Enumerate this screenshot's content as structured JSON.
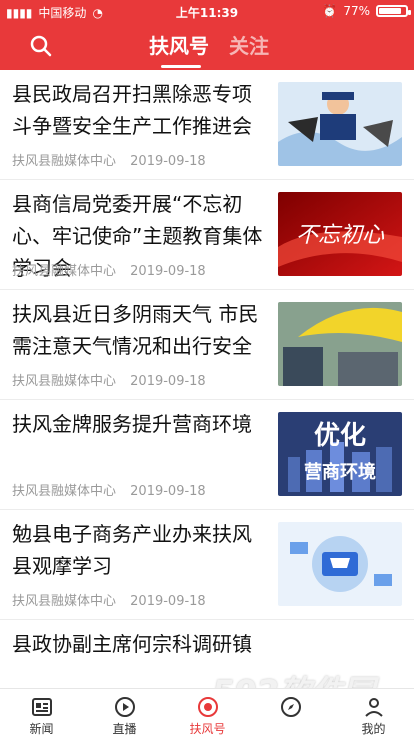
{
  "statusbar": {
    "carrier": "中国移动",
    "time": "上午11:39",
    "battery": "77%",
    "battery_level": 0.77
  },
  "header": {
    "tab_active": "扶风号",
    "tab_inactive": "关注",
    "search_icon": "search-icon"
  },
  "articles": [
    {
      "title": "县民政局召开扫黑除恶专项斗争暨安全生产工作推进会",
      "source": "扶风县融媒体中心",
      "date": "2019-09-18",
      "thumb_icon": "police-cartoon-image"
    },
    {
      "title": "县商信局党委开展“不忘初心、牢记使命”主题教育集体学习会",
      "source": "扶风县融媒体中心",
      "date": "2019-09-18",
      "thumb_icon": "red-banner-image",
      "thumb_text": "不忘初心"
    },
    {
      "title": "扶风县近日多阴雨天气 市民需注意天气情况和出行安全",
      "source": "扶风县融媒体中心",
      "date": "2019-09-18",
      "thumb_icon": "rain-umbrella-image"
    },
    {
      "title": "扶风金牌服务提升营商环境",
      "source": "扶风县融媒体中心",
      "date": "2019-09-18",
      "thumb_icon": "city-banner-image",
      "thumb_text": "优化",
      "thumb_subtext": "营商环境"
    },
    {
      "title": "勉县电子商务产业办来扶风县观摩学习",
      "source": "扶风县融媒体中心",
      "date": "2019-09-18",
      "thumb_icon": "ecommerce-image"
    },
    {
      "title": "县政协副主席何宗科调研镇",
      "source": "",
      "date": "",
      "thumb_icon": ""
    }
  ],
  "bottomnav": [
    {
      "label": "新闻",
      "icon": "news-icon"
    },
    {
      "label": "直播",
      "icon": "play-icon"
    },
    {
      "label": "扶风号",
      "icon": "fufeng-icon"
    },
    {
      "label": "",
      "icon": "discover-icon"
    },
    {
      "label": "我的",
      "icon": "profile-icon"
    }
  ],
  "watermark": {
    "main": "592软件园",
    "url": "www.592xiazai.com"
  },
  "colors": {
    "brand_red": "#e8393a"
  }
}
